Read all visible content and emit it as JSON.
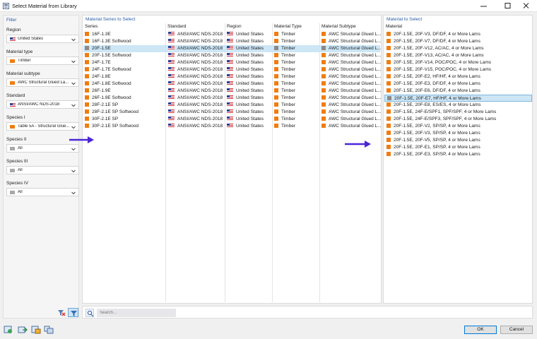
{
  "window": {
    "title": "Select Material from Library"
  },
  "filter": {
    "title": "Filter",
    "fields": [
      {
        "label": "Region",
        "value": "United States",
        "icon": "us-flag-icon"
      },
      {
        "label": "Material type",
        "value": "Timber",
        "icon": "timber-swatch-icon"
      },
      {
        "label": "Material subtype",
        "value": "AWC Structural Glued La...",
        "icon": "timber-swatch-icon"
      },
      {
        "label": "Standard",
        "value": "ANSI/AWC NDS-2018",
        "icon": "us-flag-icon"
      },
      {
        "label": "Species I",
        "value": "Table 5A - Structural Glue...",
        "icon": "timber-swatch-icon"
      },
      {
        "label": "Species II",
        "value": "All",
        "icon": "all-swatch-icon"
      },
      {
        "label": "Species III",
        "value": "All",
        "icon": "all-swatch-icon"
      },
      {
        "label": "Species IV",
        "value": "All",
        "icon": "all-swatch-icon"
      }
    ]
  },
  "series_panel": {
    "title": "Material Series to Select",
    "columns": [
      "Series",
      "Standard",
      "Region",
      "Material Type",
      "Material Subtype"
    ],
    "selected_index": 2,
    "rows": [
      {
        "series": "16F-1.3E",
        "standard": "ANSI/AWC NDS-2018",
        "region": "United States",
        "type": "Timber",
        "subtype": "AWC Structural Glued L..."
      },
      {
        "series": "16F-1.3E Softwood",
        "standard": "ANSI/AWC NDS-2018",
        "region": "United States",
        "type": "Timber",
        "subtype": "AWC Structural Glued L..."
      },
      {
        "series": "20F-1.5E",
        "standard": "ANSI/AWC NDS-2018",
        "region": "United States",
        "type": "Timber",
        "subtype": "AWC Structural Glued L..."
      },
      {
        "series": "20F-1.5E Softwood",
        "standard": "ANSI/AWC NDS-2018",
        "region": "United States",
        "type": "Timber",
        "subtype": "AWC Structural Glued L..."
      },
      {
        "series": "24F-1.7E",
        "standard": "ANSI/AWC NDS-2018",
        "region": "United States",
        "type": "Timber",
        "subtype": "AWC Structural Glued L..."
      },
      {
        "series": "24F-1.7E Softwood",
        "standard": "ANSI/AWC NDS-2018",
        "region": "United States",
        "type": "Timber",
        "subtype": "AWC Structural Glued L..."
      },
      {
        "series": "24F-1.8E",
        "standard": "ANSI/AWC NDS-2018",
        "region": "United States",
        "type": "Timber",
        "subtype": "AWC Structural Glued L..."
      },
      {
        "series": "24F-1.8E Softwood",
        "standard": "ANSI/AWC NDS-2018",
        "region": "United States",
        "type": "Timber",
        "subtype": "AWC Structural Glued L..."
      },
      {
        "series": "26F-1.9E",
        "standard": "ANSI/AWC NDS-2018",
        "region": "United States",
        "type": "Timber",
        "subtype": "AWC Structural Glued L..."
      },
      {
        "series": "26F-1.9E Softwood",
        "standard": "ANSI/AWC NDS-2018",
        "region": "United States",
        "type": "Timber",
        "subtype": "AWC Structural Glued L..."
      },
      {
        "series": "28F-2.1E SP",
        "standard": "ANSI/AWC NDS-2018",
        "region": "United States",
        "type": "Timber",
        "subtype": "AWC Structural Glued L..."
      },
      {
        "series": "28F-2.1E SP Softwood",
        "standard": "ANSI/AWC NDS-2018",
        "region": "United States",
        "type": "Timber",
        "subtype": "AWC Structural Glued L..."
      },
      {
        "series": "30F-2.1E SP",
        "standard": "ANSI/AWC NDS-2018",
        "region": "United States",
        "type": "Timber",
        "subtype": "AWC Structural Glued L..."
      },
      {
        "series": "30F-2.1E SP Softwood",
        "standard": "ANSI/AWC NDS-2018",
        "region": "United States",
        "type": "Timber",
        "subtype": "AWC Structural Glued L..."
      }
    ]
  },
  "material_panel": {
    "title": "Material to Select",
    "column": "Material",
    "selected_index": 9,
    "rows": [
      "20F-1.5E, 20F-V3, DF/DF, 4 or More Lams",
      "20F-1.5E, 20F-V7, DF/DF, 4 or More Lams",
      "20F-1.5E, 20F-V12, AC/AC, 4 or More Lams",
      "20F-1.5E, 20F-V13, AC/AC, 4 or More Lams",
      "20F-1.5E, 20F-V14, POC/POC, 4 or More Lams",
      "20F-1.5E, 20F-V15, POC/POC, 4 or More Lams",
      "20F-1.5E, 20F-E2, HF/HF, 4 or More Lams",
      "20F-1.5E, 20F-E3, DF/DF, 4 or More Lams",
      "20F-1.5E, 20F-E6, DF/DF, 4 or More Lams",
      "20F-1.5E, 20F-E7, HF/HF, 4 or More Lams",
      "20F-1.5E, 20F-E8, ES/ES, 4 or More Lams",
      "20F-1.5E, 24F-E/SPF1, SPF/SPF, 4 or More Lams",
      "20F-1.5E, 24F-E/SPF3, SPF/SPF, 4 or More Lams",
      "20F-1.5E, 20F-V2, SP/SP, 4 or More Lams",
      "20F-1.5E, 20F-V3, SP/SP, 4 or More Lams",
      "20F-1.5E, 20F-V5, SP/SP, 4 or More Lams",
      "20F-1.5E, 20F-E1, SP/SP, 4 or More Lams",
      "20F-1.5E, 20F-E3, SP/SP, 4 or More Lams"
    ]
  },
  "search": {
    "placeholder": "Search..."
  },
  "buttons": {
    "ok": "OK",
    "cancel": "Cancel"
  },
  "colors": {
    "timber": "#f07d12",
    "selected_row": "#cce6f6",
    "arrow": "#4b26d9",
    "panel_title": "#2a5da8"
  }
}
